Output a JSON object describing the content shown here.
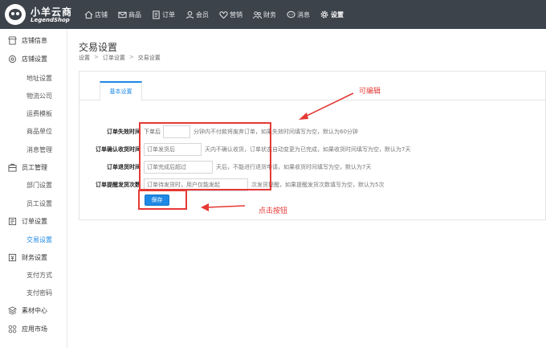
{
  "brand": {
    "name": "小羊云商",
    "sub": "LegendShop"
  },
  "nav": [
    {
      "label": "店铺",
      "icon": "home-icon"
    },
    {
      "label": "商品",
      "icon": "mail-icon"
    },
    {
      "label": "订单",
      "icon": "document-icon"
    },
    {
      "label": "会员",
      "icon": "user-icon"
    },
    {
      "label": "营销",
      "icon": "heart-icon"
    },
    {
      "label": "财务",
      "icon": "people-icon"
    },
    {
      "label": "消息",
      "icon": "chat-icon"
    },
    {
      "label": "设置",
      "icon": "gear-icon",
      "active": true
    }
  ],
  "sidebar": {
    "groups": [
      {
        "label": "店铺信息",
        "icon": "store-icon"
      },
      {
        "label": "店铺设置",
        "icon": "settings-icon"
      },
      {
        "label": "员工管理",
        "icon": "staff-icon"
      },
      {
        "label": "订单设置",
        "icon": "order-icon"
      },
      {
        "label": "财务设置",
        "icon": "finance-icon"
      },
      {
        "label": "素材中心",
        "icon": "layers-icon"
      },
      {
        "label": "应用市场",
        "icon": "apps-icon"
      }
    ],
    "subs": {
      "store_settings": [
        "地址设置",
        "物流公司",
        "运费模板",
        "商品单位",
        "消息管理"
      ],
      "staff": [
        "部门设置",
        "员工设置"
      ],
      "order": [
        "交易设置"
      ],
      "finance": [
        "支付方式",
        "支付密码"
      ]
    }
  },
  "page": {
    "title": "交易设置",
    "breadcrumb": [
      "设置",
      "订单设置",
      "交易设置"
    ]
  },
  "tab": {
    "label": "基本设置"
  },
  "form": {
    "rows": [
      {
        "label": "订单失效时间",
        "prefix": "下单后",
        "input_value": "",
        "suffix": "分钟内不付款将废弃订单，如果失效时间填写为空，默认为60分钟"
      },
      {
        "label": "订单确认收货时间",
        "prefix": "",
        "input_value": "订单发货后",
        "suffix": "天内不确认收货，订单状态自动变更为已完成，如果收货时间填写为空，默认为7天"
      },
      {
        "label": "订单退货时间",
        "prefix": "",
        "input_value": "订单完成后超过",
        "suffix": "天后，不能进行退货申请，如果收货时间填写为空，默认为7天"
      },
      {
        "label": "订单提醒发货次数",
        "prefix": "",
        "input_value": "订单待发货时，用户仅能发起",
        "suffix": "次发货提醒，如果提醒发货次数填写为空，默认为5次"
      }
    ],
    "save_label": "保存"
  },
  "annotations": {
    "collapsible": "可编辑",
    "click_button": "点击按钮",
    "color": "#e53935"
  }
}
